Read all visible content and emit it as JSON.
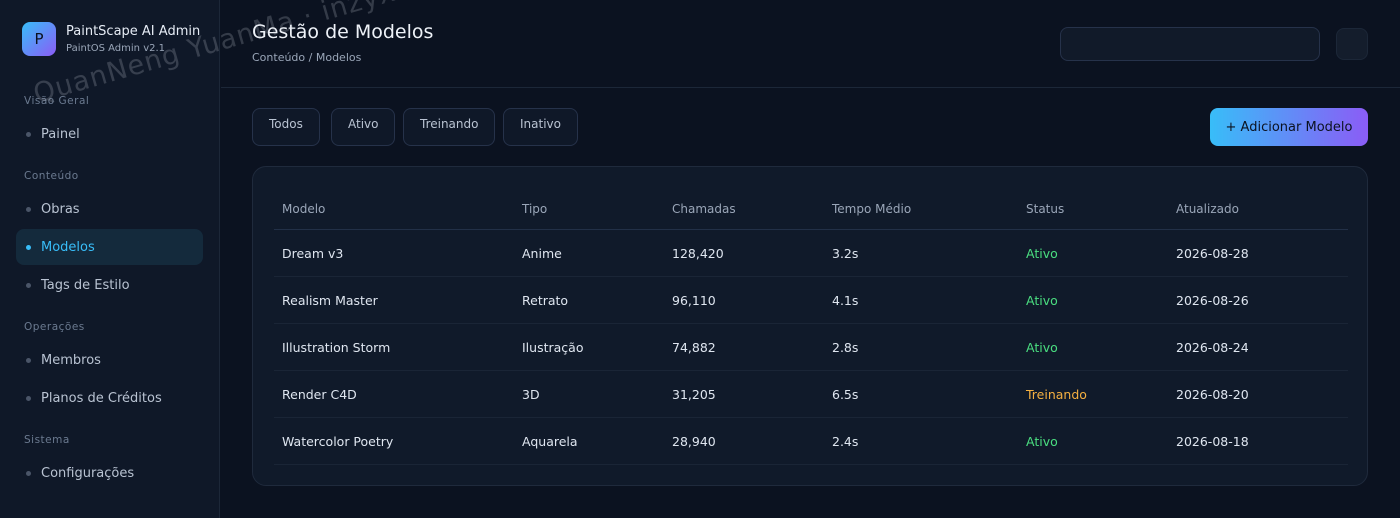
{
  "brand": {
    "logo_letter": "P",
    "name": "PaintScape AI Admin",
    "version": "PaintOS Admin v2.1"
  },
  "sidebar": {
    "sections": [
      {
        "label": "Visão Geral",
        "items": [
          {
            "label": "Painel",
            "active": false
          }
        ]
      },
      {
        "label": "Conteúdo",
        "items": [
          {
            "label": "Obras",
            "active": false
          },
          {
            "label": "Modelos",
            "active": true
          },
          {
            "label": "Tags de Estilo",
            "active": false
          }
        ]
      },
      {
        "label": "Operações",
        "items": [
          {
            "label": "Membros",
            "active": false
          },
          {
            "label": "Planos de Créditos",
            "active": false
          }
        ]
      },
      {
        "label": "Sistema",
        "items": [
          {
            "label": "Configurações",
            "active": false
          }
        ]
      }
    ]
  },
  "header": {
    "title": "Gestão de Modelos",
    "breadcrumb": "Conteúdo / Modelos",
    "search_value": ""
  },
  "filters": [
    "Todos",
    "Ativo",
    "Treinando",
    "Inativo"
  ],
  "add_button_label": "+ Adicionar Modelo",
  "table": {
    "columns": [
      "Modelo",
      "Tipo",
      "Chamadas",
      "Tempo Médio",
      "Status",
      "Atualizado"
    ],
    "rows": [
      {
        "modelo": "Dream v3",
        "tipo": "Anime",
        "chamadas": "128,420",
        "tempo": "3.2s",
        "status": "Ativo",
        "atualizado": "2026-08-28"
      },
      {
        "modelo": "Realism Master",
        "tipo": "Retrato",
        "chamadas": "96,110",
        "tempo": "4.1s",
        "status": "Ativo",
        "atualizado": "2026-08-26"
      },
      {
        "modelo": "Illustration Storm",
        "tipo": "Ilustração",
        "chamadas": "74,882",
        "tempo": "2.8s",
        "status": "Ativo",
        "atualizado": "2026-08-24"
      },
      {
        "modelo": "Render C4D",
        "tipo": "3D",
        "chamadas": "31,205",
        "tempo": "6.5s",
        "status": "Treinando",
        "atualizado": "2026-08-20"
      },
      {
        "modelo": "Watercolor Poetry",
        "tipo": "Aquarela",
        "chamadas": "28,940",
        "tempo": "2.4s",
        "status": "Ativo",
        "atualizado": "2026-08-18"
      }
    ]
  },
  "watermark": "QuanNeng YuanMa · inzyxuashop.com",
  "colors": {
    "accent": "#38bdf8",
    "accent_secondary": "#8b5cf6",
    "status_ativo": "#4ade80",
    "status_treinando": "#f5b041"
  }
}
